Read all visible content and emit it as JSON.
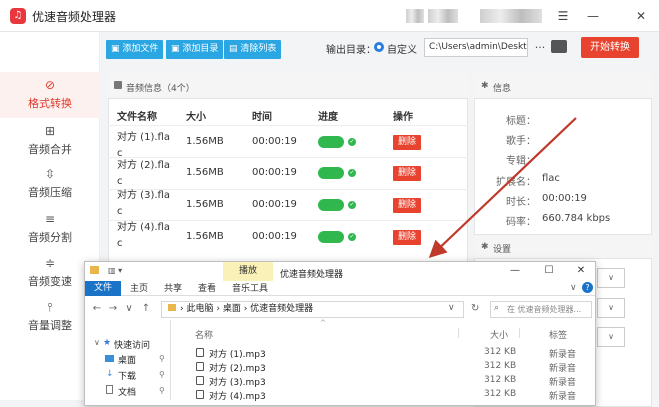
{
  "app": {
    "title": "优速音频处理器",
    "logo_glyph": "♫"
  },
  "window_controls": {
    "menu": "☰",
    "minimize": "—",
    "close": "✕"
  },
  "sidebar": {
    "items": [
      {
        "label": "格式转换",
        "icon": "format-icon",
        "glyph": "⊘",
        "active": true
      },
      {
        "label": "音频合并",
        "icon": "merge-icon",
        "glyph": "⊞",
        "active": false
      },
      {
        "label": "音频压缩",
        "icon": "compress-icon",
        "glyph": "⇳",
        "active": false
      },
      {
        "label": "音频分割",
        "icon": "split-icon",
        "glyph": "≡",
        "active": false
      },
      {
        "label": "音频变速",
        "icon": "speed-icon",
        "glyph": "≑",
        "active": false
      },
      {
        "label": "音量调整",
        "icon": "volume-icon",
        "glyph": "⫯",
        "active": false
      }
    ]
  },
  "toolbar": {
    "add_file": "添加文件",
    "add_dir": "添加目录",
    "clear_list": "清除列表",
    "output_label": "输出目录：",
    "custom_label": "自定义",
    "path_value": "C:\\Users\\admin\\Deskto",
    "more": "···",
    "start": "开始转换"
  },
  "audio_panel": {
    "title": "音频信息（4个）",
    "columns": [
      "文件名称",
      "大小",
      "时间",
      "进度",
      "操作"
    ],
    "rows": [
      {
        "name1": "对方 (1).fla",
        "name2": "c",
        "size": "1.56MB",
        "time": "00:00:19",
        "action": "删除"
      },
      {
        "name1": "对方 (2).fla",
        "name2": "c",
        "size": "1.56MB",
        "time": "00:00:19",
        "action": "删除"
      },
      {
        "name1": "对方 (3).fla",
        "name2": "c",
        "size": "1.56MB",
        "time": "00:00:19",
        "action": "删除"
      },
      {
        "name1": "对方 (4).fla",
        "name2": "c",
        "size": "1.56MB",
        "time": "00:00:19",
        "action": "删除"
      }
    ],
    "done_glyph": "✓"
  },
  "info_panel": {
    "title": "信息",
    "fields": [
      {
        "key": "标题：",
        "value": ""
      },
      {
        "key": "歌手：",
        "value": ""
      },
      {
        "key": "专辑：",
        "value": ""
      },
      {
        "key": "扩展名：",
        "value": "flac"
      },
      {
        "key": "时长：",
        "value": "00:00:19"
      },
      {
        "key": "码率：",
        "value": "660.784 kbps"
      }
    ]
  },
  "settings_panel": {
    "title": "设置"
  },
  "explorer": {
    "title": "优速音频处理器",
    "play_tab": "播放",
    "music_tools_tab": "音乐工具",
    "tabs": [
      "文件",
      "主页",
      "共享",
      "查看"
    ],
    "window": {
      "minimize": "—",
      "maximize": "☐",
      "close": "✕"
    },
    "breadcrumb": [
      "此电脑",
      "桌面",
      "优速音频处理器"
    ],
    "search_placeholder": "在 优速音频处理器...",
    "columns": [
      "名称",
      "大小",
      "标签"
    ],
    "nav": [
      {
        "label": "快速访问",
        "pinned": false
      },
      {
        "label": "桌面",
        "pinned": true
      },
      {
        "label": "下载",
        "pinned": true
      },
      {
        "label": "文档",
        "pinned": true
      }
    ],
    "files": [
      {
        "name": "对方 (1).mp3",
        "size": "312 KB",
        "tag": "新录音"
      },
      {
        "name": "对方 (2).mp3",
        "size": "312 KB",
        "tag": "新录音"
      },
      {
        "name": "对方 (3).mp3",
        "size": "312 KB",
        "tag": "新录音"
      },
      {
        "name": "对方 (4).mp3",
        "size": "312 KB",
        "tag": "新录音"
      }
    ]
  },
  "colors": {
    "accent_red": "#e8432e",
    "toolbar_blue": "#2aa6e3",
    "progress_green": "#30b84f",
    "arrow_red": "#c0392b"
  }
}
